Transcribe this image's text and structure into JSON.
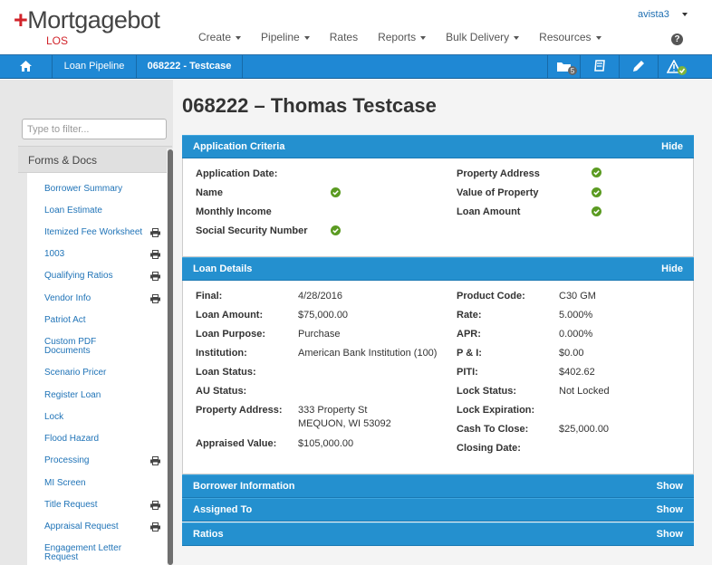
{
  "header": {
    "logo_plus": "+",
    "logo_text": "Mortgagebot",
    "logo_sub": "LOS",
    "menu": [
      {
        "label": "Create"
      },
      {
        "label": "Pipeline"
      },
      {
        "label": "Rates"
      },
      {
        "label": "Reports"
      },
      {
        "label": "Bulk Delivery"
      },
      {
        "label": "Resources"
      }
    ],
    "user": "avista3",
    "help_glyph": "?"
  },
  "nav": {
    "breadcrumb": [
      "Loan Pipeline",
      "068222 - Testcase"
    ],
    "folder_badge": "5",
    "icons": [
      "home-icon",
      "folder-icon",
      "book-icon",
      "pencil-icon",
      "warning-check-icon"
    ]
  },
  "sidebar": {
    "filter_placeholder": "Type to filter...",
    "section": "Forms & Docs",
    "items": [
      {
        "label": "Borrower Summary"
      },
      {
        "label": "Loan Estimate"
      },
      {
        "label": "Itemized Fee Worksheet"
      },
      {
        "label": "1003"
      },
      {
        "label": "Qualifying Ratios"
      },
      {
        "label": "Vendor Info"
      },
      {
        "label": "Patriot Act"
      },
      {
        "label": "Custom PDF Documents"
      },
      {
        "label": "Scenario Pricer"
      },
      {
        "label": "Register Loan"
      },
      {
        "label": "Lock"
      },
      {
        "label": "Flood Hazard"
      },
      {
        "label": "Processing"
      },
      {
        "label": "MI Screen"
      },
      {
        "label": "Title Request"
      },
      {
        "label": "Appraisal Request"
      },
      {
        "label": "Engagement Letter Request"
      }
    ]
  },
  "main": {
    "title": "068222 – Thomas Testcase",
    "application_criteria": {
      "title": "Application Criteria",
      "toggle": "Hide",
      "left": [
        {
          "label": "Application Date:",
          "status": "none"
        },
        {
          "label": "Name",
          "status": "ok"
        },
        {
          "label": "Monthly Income",
          "status": "none"
        },
        {
          "label": "Social Security Number",
          "status": "ok"
        }
      ],
      "right": [
        {
          "label": "Property Address",
          "status": "ok"
        },
        {
          "label": "Value of Property",
          "status": "ok"
        },
        {
          "label": "Loan Amount",
          "status": "ok"
        }
      ]
    },
    "loan_details": {
      "title": "Loan Details",
      "toggle": "Hide",
      "left": [
        {
          "label": "Final:",
          "value": "4/28/2016"
        },
        {
          "label": "Loan Amount:",
          "value": "$75,000.00"
        },
        {
          "label": "Loan Purpose:",
          "value": "Purchase"
        },
        {
          "label": "Institution:",
          "value": "American Bank Institution (100)"
        },
        {
          "label": "Loan Status:",
          "value": ""
        },
        {
          "label": "AU Status:",
          "value": ""
        },
        {
          "label": "Property Address:",
          "value": "333 Property St",
          "value2": "MEQUON, WI 53092"
        },
        {
          "label": "Appraised Value:",
          "value": "$105,000.00"
        }
      ],
      "right": [
        {
          "label": "Product Code:",
          "value": "C30 GM"
        },
        {
          "label": "Rate:",
          "value": "5.000%"
        },
        {
          "label": "APR:",
          "value": "0.000%"
        },
        {
          "label": "P & I:",
          "value": "$0.00"
        },
        {
          "label": "PITI:",
          "value": "$402.62"
        },
        {
          "label": "Lock Status:",
          "value": "Not Locked"
        },
        {
          "label": "Lock Expiration:",
          "value": ""
        },
        {
          "label": "Cash To Close:",
          "value": "$25,000.00"
        },
        {
          "label": "Closing Date:",
          "value": ""
        }
      ]
    },
    "collapsed_sections": [
      {
        "title": "Borrower Information",
        "toggle": "Show"
      },
      {
        "title": "Assigned To",
        "toggle": "Show"
      },
      {
        "title": "Ratios",
        "toggle": "Show"
      }
    ]
  },
  "colors": {
    "brand_red": "#d1232a",
    "nav_blue": "#1f88d4",
    "section_blue": "#2490cf",
    "ok_green": "#5b9b22",
    "link_blue": "#1f73b7"
  }
}
